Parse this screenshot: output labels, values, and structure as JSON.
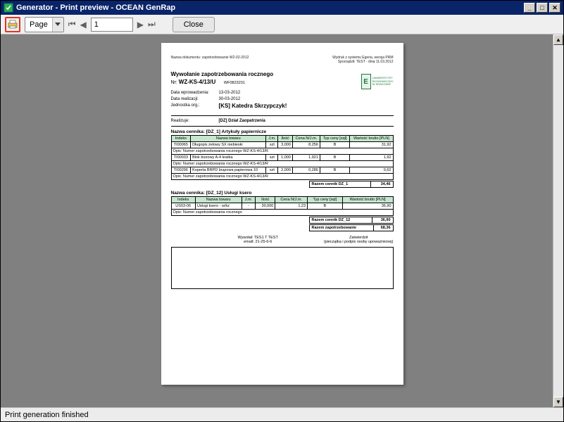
{
  "window": {
    "title": "Generator  - Print preview - OCEAN GenRap"
  },
  "toolbar": {
    "page_combo_label": "Page",
    "page_value": "1",
    "close_label": "Close"
  },
  "statusbar": {
    "text": "Print generation finished"
  },
  "doc": {
    "hdr_left": "Nazwa dokumentu: zapotrzebowanie  W2-02-2012",
    "hdr_r1": "Wydruk z systemu Egeria, wersja PRM",
    "hdr_r2": "Sporządził: TEST - dnia 11.03.2012",
    "title_line1": "Wywołanie zapotrzebowania rocznego",
    "title_line2_label": "Nr:",
    "title_line2_val": "WZ-KS-4/13/U",
    "title_line2_extra": "WF0823231",
    "kv1_label": "Data wprowadzenia:",
    "kv1_val": "13-03-2012",
    "kv2_label": "Data realizacji:",
    "kv2_val": "30-03-2012",
    "kv3_label": "Jednostka org.:",
    "kv3_val": "[KS] Katedra Skrzypczyk!",
    "kv4_label": "Realizuje:",
    "kv4_val": "[DZ] Dział Zaopatrzenia",
    "sec1_title": "Nazwa cennika: [DZ_1] Artykuły papiernicze",
    "sec2_title": "Nazwa cennika: [DZ_12] Usługi ksero",
    "tbl_h_indeks": "Indeks",
    "tbl_h_nazwa": "Nazwa towaru",
    "tbl_h_jm": "J.m.",
    "tbl_h_ilosc": "Ilość",
    "tbl_h_cena": "Cena N/J.m.",
    "tbl_h_typ": "Typ ceny [sql]",
    "tbl_h_wart": "Wartość brutto [PLN]",
    "row_opis_lbl": "Opis:  Numer zapotrzebowania rocznego WZ-KS-4/13/R",
    "sec1_rows": [
      {
        "indeks": "TI00065",
        "nazwa": "Długopis żelowy SX niebieski",
        "jm": "szt",
        "ilosc": "3,000",
        "cena": "8,256",
        "typ": "B",
        "wart": "31,92"
      },
      {
        "indeks": "TI00033",
        "nazwa": "Blok biurowy A-4 kratka",
        "jm": "szt",
        "ilosc": "1,000",
        "cena": "1,921",
        "typ": "B",
        "wart": "1,92"
      },
      {
        "indeks": "TI00296",
        "nazwa": "Koperta BRPD brązowa papierowa 10",
        "jm": "szt",
        "ilosc": "2,000",
        "cena": "0,286",
        "typ": "B",
        "wart": "0,62"
      }
    ],
    "sec1_sum_lbl": "Razem cennik DZ_1",
    "sec1_sum_val": "34,46",
    "sec2_rows": [
      {
        "indeks": "US03-06",
        "nazwa": "Usługi ksero - w/kz",
        "jm": "-",
        "ilosc": "30,000",
        "cena": "1,23",
        "typ": "B",
        "wart": "36,90"
      }
    ],
    "row_opis_lbl2": "Opis:  Numer zapotrzebowania rocznego",
    "sec2_sum_lbl": "Razem cennik DZ_12",
    "sec2_sum_val": "36,90",
    "total_lbl": "Razem zapotrzebowanie",
    "total_val": "68,36",
    "sign_l1": "Wywołał:   TES1 T TEST",
    "sign_l2": "emalt:   21-25-6-6",
    "sign_r1": "Zatwierdził",
    "sign_r2": "(pieczątka i podpis osoby upoważnionej)"
  }
}
